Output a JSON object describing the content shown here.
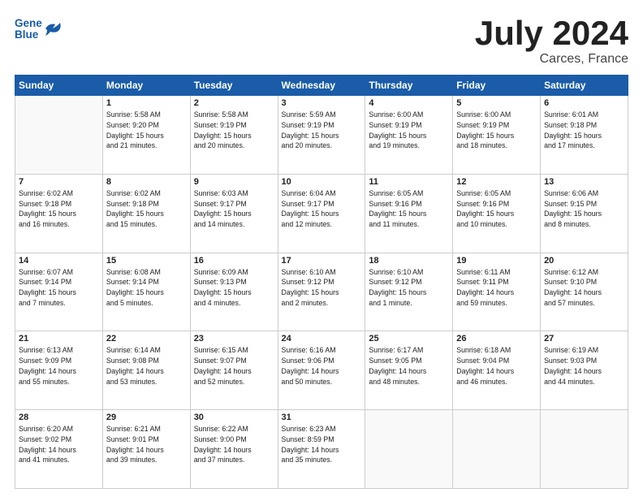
{
  "header": {
    "logo_line1": "General",
    "logo_line2": "Blue",
    "title": "July 2024",
    "location": "Carces, France"
  },
  "days_of_week": [
    "Sunday",
    "Monday",
    "Tuesday",
    "Wednesday",
    "Thursday",
    "Friday",
    "Saturday"
  ],
  "weeks": [
    [
      {
        "day": "",
        "info": ""
      },
      {
        "day": "1",
        "info": "Sunrise: 5:58 AM\nSunset: 9:20 PM\nDaylight: 15 hours\nand 21 minutes."
      },
      {
        "day": "2",
        "info": "Sunrise: 5:58 AM\nSunset: 9:19 PM\nDaylight: 15 hours\nand 20 minutes."
      },
      {
        "day": "3",
        "info": "Sunrise: 5:59 AM\nSunset: 9:19 PM\nDaylight: 15 hours\nand 20 minutes."
      },
      {
        "day": "4",
        "info": "Sunrise: 6:00 AM\nSunset: 9:19 PM\nDaylight: 15 hours\nand 19 minutes."
      },
      {
        "day": "5",
        "info": "Sunrise: 6:00 AM\nSunset: 9:19 PM\nDaylight: 15 hours\nand 18 minutes."
      },
      {
        "day": "6",
        "info": "Sunrise: 6:01 AM\nSunset: 9:18 PM\nDaylight: 15 hours\nand 17 minutes."
      }
    ],
    [
      {
        "day": "7",
        "info": "Sunrise: 6:02 AM\nSunset: 9:18 PM\nDaylight: 15 hours\nand 16 minutes."
      },
      {
        "day": "8",
        "info": "Sunrise: 6:02 AM\nSunset: 9:18 PM\nDaylight: 15 hours\nand 15 minutes."
      },
      {
        "day": "9",
        "info": "Sunrise: 6:03 AM\nSunset: 9:17 PM\nDaylight: 15 hours\nand 14 minutes."
      },
      {
        "day": "10",
        "info": "Sunrise: 6:04 AM\nSunset: 9:17 PM\nDaylight: 15 hours\nand 12 minutes."
      },
      {
        "day": "11",
        "info": "Sunrise: 6:05 AM\nSunset: 9:16 PM\nDaylight: 15 hours\nand 11 minutes."
      },
      {
        "day": "12",
        "info": "Sunrise: 6:05 AM\nSunset: 9:16 PM\nDaylight: 15 hours\nand 10 minutes."
      },
      {
        "day": "13",
        "info": "Sunrise: 6:06 AM\nSunset: 9:15 PM\nDaylight: 15 hours\nand 8 minutes."
      }
    ],
    [
      {
        "day": "14",
        "info": "Sunrise: 6:07 AM\nSunset: 9:14 PM\nDaylight: 15 hours\nand 7 minutes."
      },
      {
        "day": "15",
        "info": "Sunrise: 6:08 AM\nSunset: 9:14 PM\nDaylight: 15 hours\nand 5 minutes."
      },
      {
        "day": "16",
        "info": "Sunrise: 6:09 AM\nSunset: 9:13 PM\nDaylight: 15 hours\nand 4 minutes."
      },
      {
        "day": "17",
        "info": "Sunrise: 6:10 AM\nSunset: 9:12 PM\nDaylight: 15 hours\nand 2 minutes."
      },
      {
        "day": "18",
        "info": "Sunrise: 6:10 AM\nSunset: 9:12 PM\nDaylight: 15 hours\nand 1 minute."
      },
      {
        "day": "19",
        "info": "Sunrise: 6:11 AM\nSunset: 9:11 PM\nDaylight: 14 hours\nand 59 minutes."
      },
      {
        "day": "20",
        "info": "Sunrise: 6:12 AM\nSunset: 9:10 PM\nDaylight: 14 hours\nand 57 minutes."
      }
    ],
    [
      {
        "day": "21",
        "info": "Sunrise: 6:13 AM\nSunset: 9:09 PM\nDaylight: 14 hours\nand 55 minutes."
      },
      {
        "day": "22",
        "info": "Sunrise: 6:14 AM\nSunset: 9:08 PM\nDaylight: 14 hours\nand 53 minutes."
      },
      {
        "day": "23",
        "info": "Sunrise: 6:15 AM\nSunset: 9:07 PM\nDaylight: 14 hours\nand 52 minutes."
      },
      {
        "day": "24",
        "info": "Sunrise: 6:16 AM\nSunset: 9:06 PM\nDaylight: 14 hours\nand 50 minutes."
      },
      {
        "day": "25",
        "info": "Sunrise: 6:17 AM\nSunset: 9:05 PM\nDaylight: 14 hours\nand 48 minutes."
      },
      {
        "day": "26",
        "info": "Sunrise: 6:18 AM\nSunset: 9:04 PM\nDaylight: 14 hours\nand 46 minutes."
      },
      {
        "day": "27",
        "info": "Sunrise: 6:19 AM\nSunset: 9:03 PM\nDaylight: 14 hours\nand 44 minutes."
      }
    ],
    [
      {
        "day": "28",
        "info": "Sunrise: 6:20 AM\nSunset: 9:02 PM\nDaylight: 14 hours\nand 41 minutes."
      },
      {
        "day": "29",
        "info": "Sunrise: 6:21 AM\nSunset: 9:01 PM\nDaylight: 14 hours\nand 39 minutes."
      },
      {
        "day": "30",
        "info": "Sunrise: 6:22 AM\nSunset: 9:00 PM\nDaylight: 14 hours\nand 37 minutes."
      },
      {
        "day": "31",
        "info": "Sunrise: 6:23 AM\nSunset: 8:59 PM\nDaylight: 14 hours\nand 35 minutes."
      },
      {
        "day": "",
        "info": ""
      },
      {
        "day": "",
        "info": ""
      },
      {
        "day": "",
        "info": ""
      }
    ]
  ]
}
